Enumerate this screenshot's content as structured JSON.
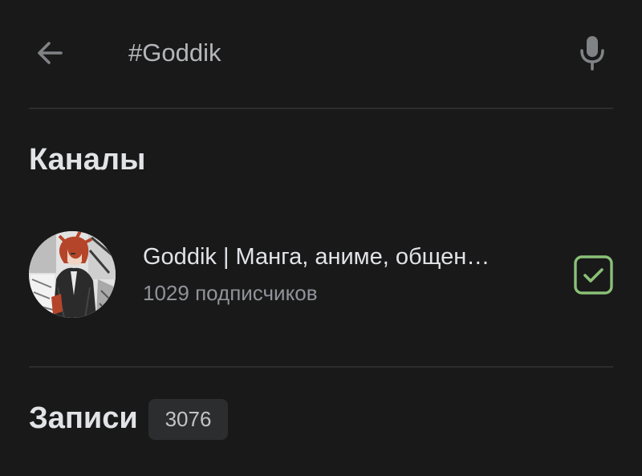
{
  "search": {
    "query": "#Goddik"
  },
  "icons": {
    "back": "arrow-left-icon",
    "mic": "microphone-icon",
    "subscribed": "checkbox-checked-icon"
  },
  "colors": {
    "background": "#19191a",
    "accent_green": "#8ac176",
    "text_primary": "#e1e3e6",
    "text_secondary": "#909399"
  },
  "channels_section": {
    "title": "Каналы",
    "items": [
      {
        "name": "Goddik | Манга, аниме, общен…",
        "subscribers": "1029 подписчиков",
        "subscribed": true
      }
    ]
  },
  "posts_section": {
    "title": "Записи",
    "count": "3076"
  }
}
